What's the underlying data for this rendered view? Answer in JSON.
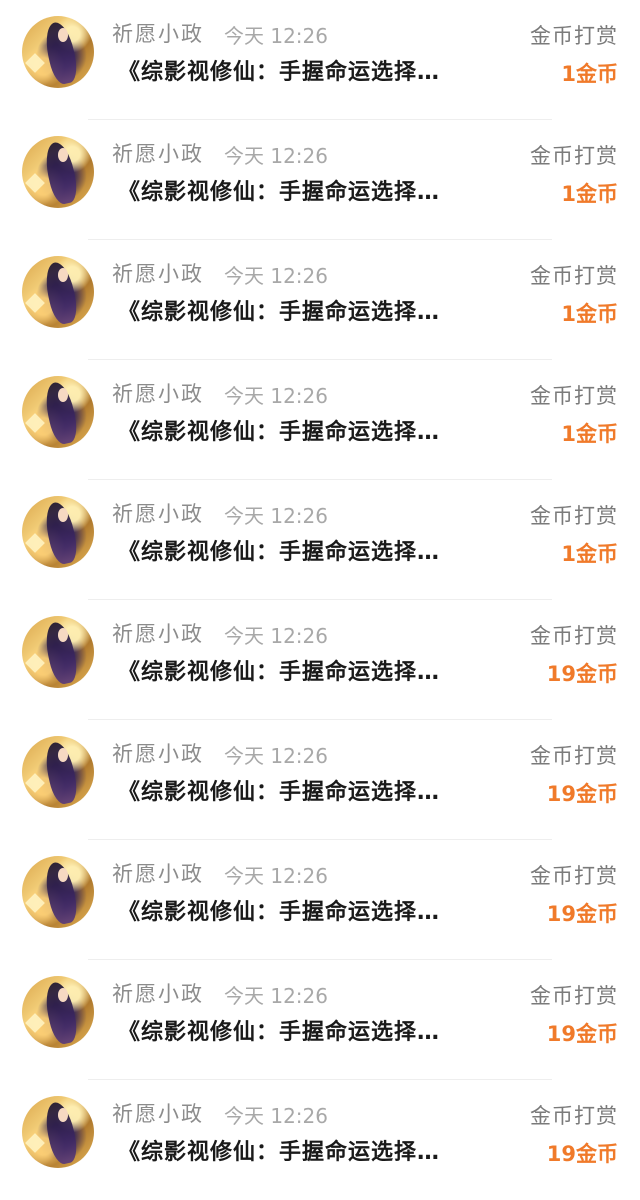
{
  "items": [
    {
      "name": "祈愿小政",
      "time": "今天 12:26",
      "title": "《综影视修仙：手握命运选择…",
      "reward_label": "金币打赏",
      "reward_amount": "1金币"
    },
    {
      "name": "祈愿小政",
      "time": "今天 12:26",
      "title": "《综影视修仙：手握命运选择…",
      "reward_label": "金币打赏",
      "reward_amount": "1金币"
    },
    {
      "name": "祈愿小政",
      "time": "今天 12:26",
      "title": "《综影视修仙：手握命运选择…",
      "reward_label": "金币打赏",
      "reward_amount": "1金币"
    },
    {
      "name": "祈愿小政",
      "time": "今天 12:26",
      "title": "《综影视修仙：手握命运选择…",
      "reward_label": "金币打赏",
      "reward_amount": "1金币"
    },
    {
      "name": "祈愿小政",
      "time": "今天 12:26",
      "title": "《综影视修仙：手握命运选择…",
      "reward_label": "金币打赏",
      "reward_amount": "1金币"
    },
    {
      "name": "祈愿小政",
      "time": "今天 12:26",
      "title": "《综影视修仙：手握命运选择…",
      "reward_label": "金币打赏",
      "reward_amount": "19金币"
    },
    {
      "name": "祈愿小政",
      "time": "今天 12:26",
      "title": "《综影视修仙：手握命运选择…",
      "reward_label": "金币打赏",
      "reward_amount": "19金币"
    },
    {
      "name": "祈愿小政",
      "time": "今天 12:26",
      "title": "《综影视修仙：手握命运选择…",
      "reward_label": "金币打赏",
      "reward_amount": "19金币"
    },
    {
      "name": "祈愿小政",
      "time": "今天 12:26",
      "title": "《综影视修仙：手握命运选择…",
      "reward_label": "金币打赏",
      "reward_amount": "19金币"
    },
    {
      "name": "祈愿小政",
      "time": "今天 12:26",
      "title": "《综影视修仙：手握命运选择…",
      "reward_label": "金币打赏",
      "reward_amount": "19金币"
    }
  ],
  "colors": {
    "accent": "#f07a2a",
    "muted": "#8c8c8c",
    "title": "#1a1a1a"
  }
}
